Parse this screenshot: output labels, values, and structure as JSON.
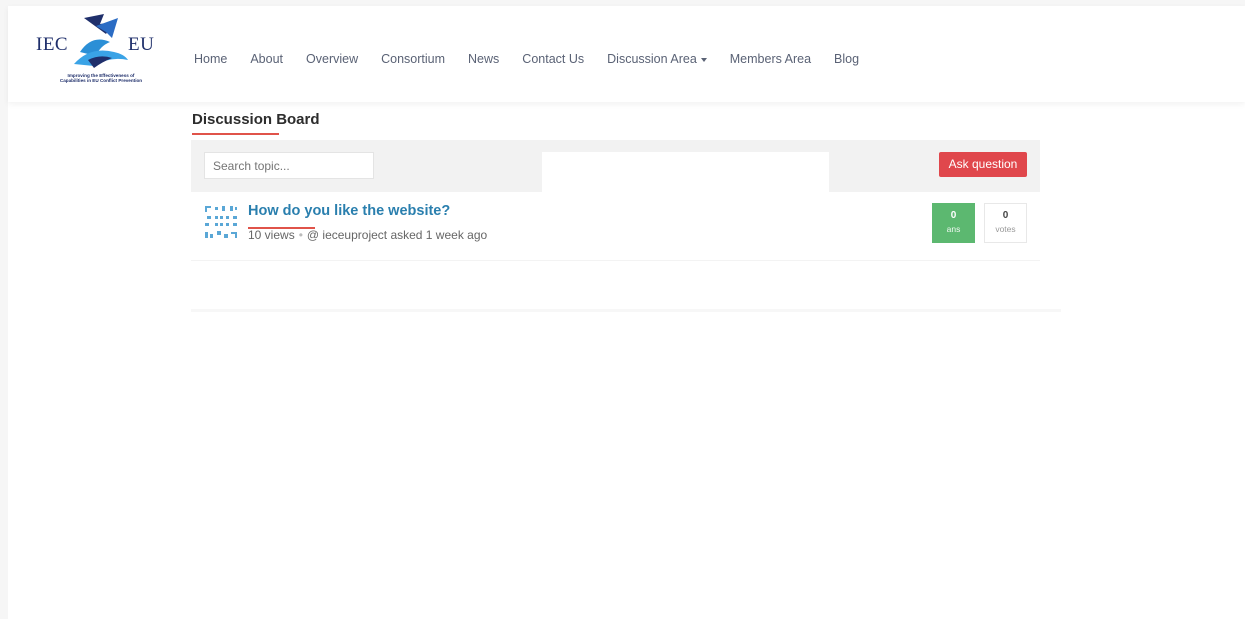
{
  "logo": {
    "left_text": "IEC",
    "right_text": "EU",
    "tagline_line1": "Improving the Effectiveness of",
    "tagline_line2": "Capabilities in EU Conflict Prevention"
  },
  "nav": {
    "items": [
      "Home",
      "About",
      "Overview",
      "Consortium",
      "News",
      "Contact Us",
      "Discussion Area",
      "Members Area",
      "Blog"
    ]
  },
  "board": {
    "title": "Discussion Board",
    "search_placeholder": "Search topic...",
    "ask_label": "Ask question"
  },
  "questions": [
    {
      "title": "How do you like the website?",
      "views": "10 views",
      "separator": "•",
      "author_meta": "@ ieceuproject asked 1 week ago",
      "answers_count": "0",
      "answers_label": "ans",
      "votes_count": "0",
      "votes_label": "votes"
    }
  ],
  "colors": {
    "accent_red": "#e0474c",
    "answers_green": "#5cb870",
    "link_blue": "#2a7fae",
    "logo_navy": "#1f2f6b"
  }
}
